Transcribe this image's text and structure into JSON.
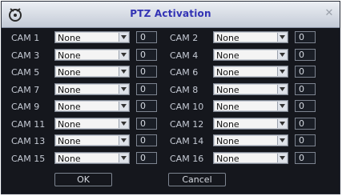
{
  "window": {
    "title": "PTZ Activation"
  },
  "rows": [
    {
      "left": {
        "cam": "CAM 1",
        "value": "None",
        "num": "0"
      },
      "right": {
        "cam": "CAM 2",
        "value": "None",
        "num": "0"
      }
    },
    {
      "left": {
        "cam": "CAM 3",
        "value": "None",
        "num": "0"
      },
      "right": {
        "cam": "CAM 4",
        "value": "None",
        "num": "0"
      }
    },
    {
      "left": {
        "cam": "CAM 5",
        "value": "None",
        "num": "0"
      },
      "right": {
        "cam": "CAM 6",
        "value": "None",
        "num": "0"
      }
    },
    {
      "left": {
        "cam": "CAM 7",
        "value": "None",
        "num": "0"
      },
      "right": {
        "cam": "CAM 8",
        "value": "None",
        "num": "0"
      }
    },
    {
      "left": {
        "cam": "CAM 9",
        "value": "None",
        "num": "0"
      },
      "right": {
        "cam": "CAM 10",
        "value": "None",
        "num": "0"
      }
    },
    {
      "left": {
        "cam": "CAM 11",
        "value": "None",
        "num": "0"
      },
      "right": {
        "cam": "CAM 12",
        "value": "None",
        "num": "0"
      }
    },
    {
      "left": {
        "cam": "CAM 13",
        "value": "None",
        "num": "0"
      },
      "right": {
        "cam": "CAM 14",
        "value": "None",
        "num": "0"
      }
    },
    {
      "left": {
        "cam": "CAM 15",
        "value": "None",
        "num": "0"
      },
      "right": {
        "cam": "CAM 16",
        "value": "None",
        "num": "0"
      }
    }
  ],
  "buttons": {
    "ok": "OK",
    "cancel": "Cancel"
  },
  "icons": {
    "app": "app-logo-icon",
    "close": "close-icon"
  },
  "colors": {
    "title": "#3232b4",
    "panel": "#15171d",
    "label": "#c5cad4"
  }
}
